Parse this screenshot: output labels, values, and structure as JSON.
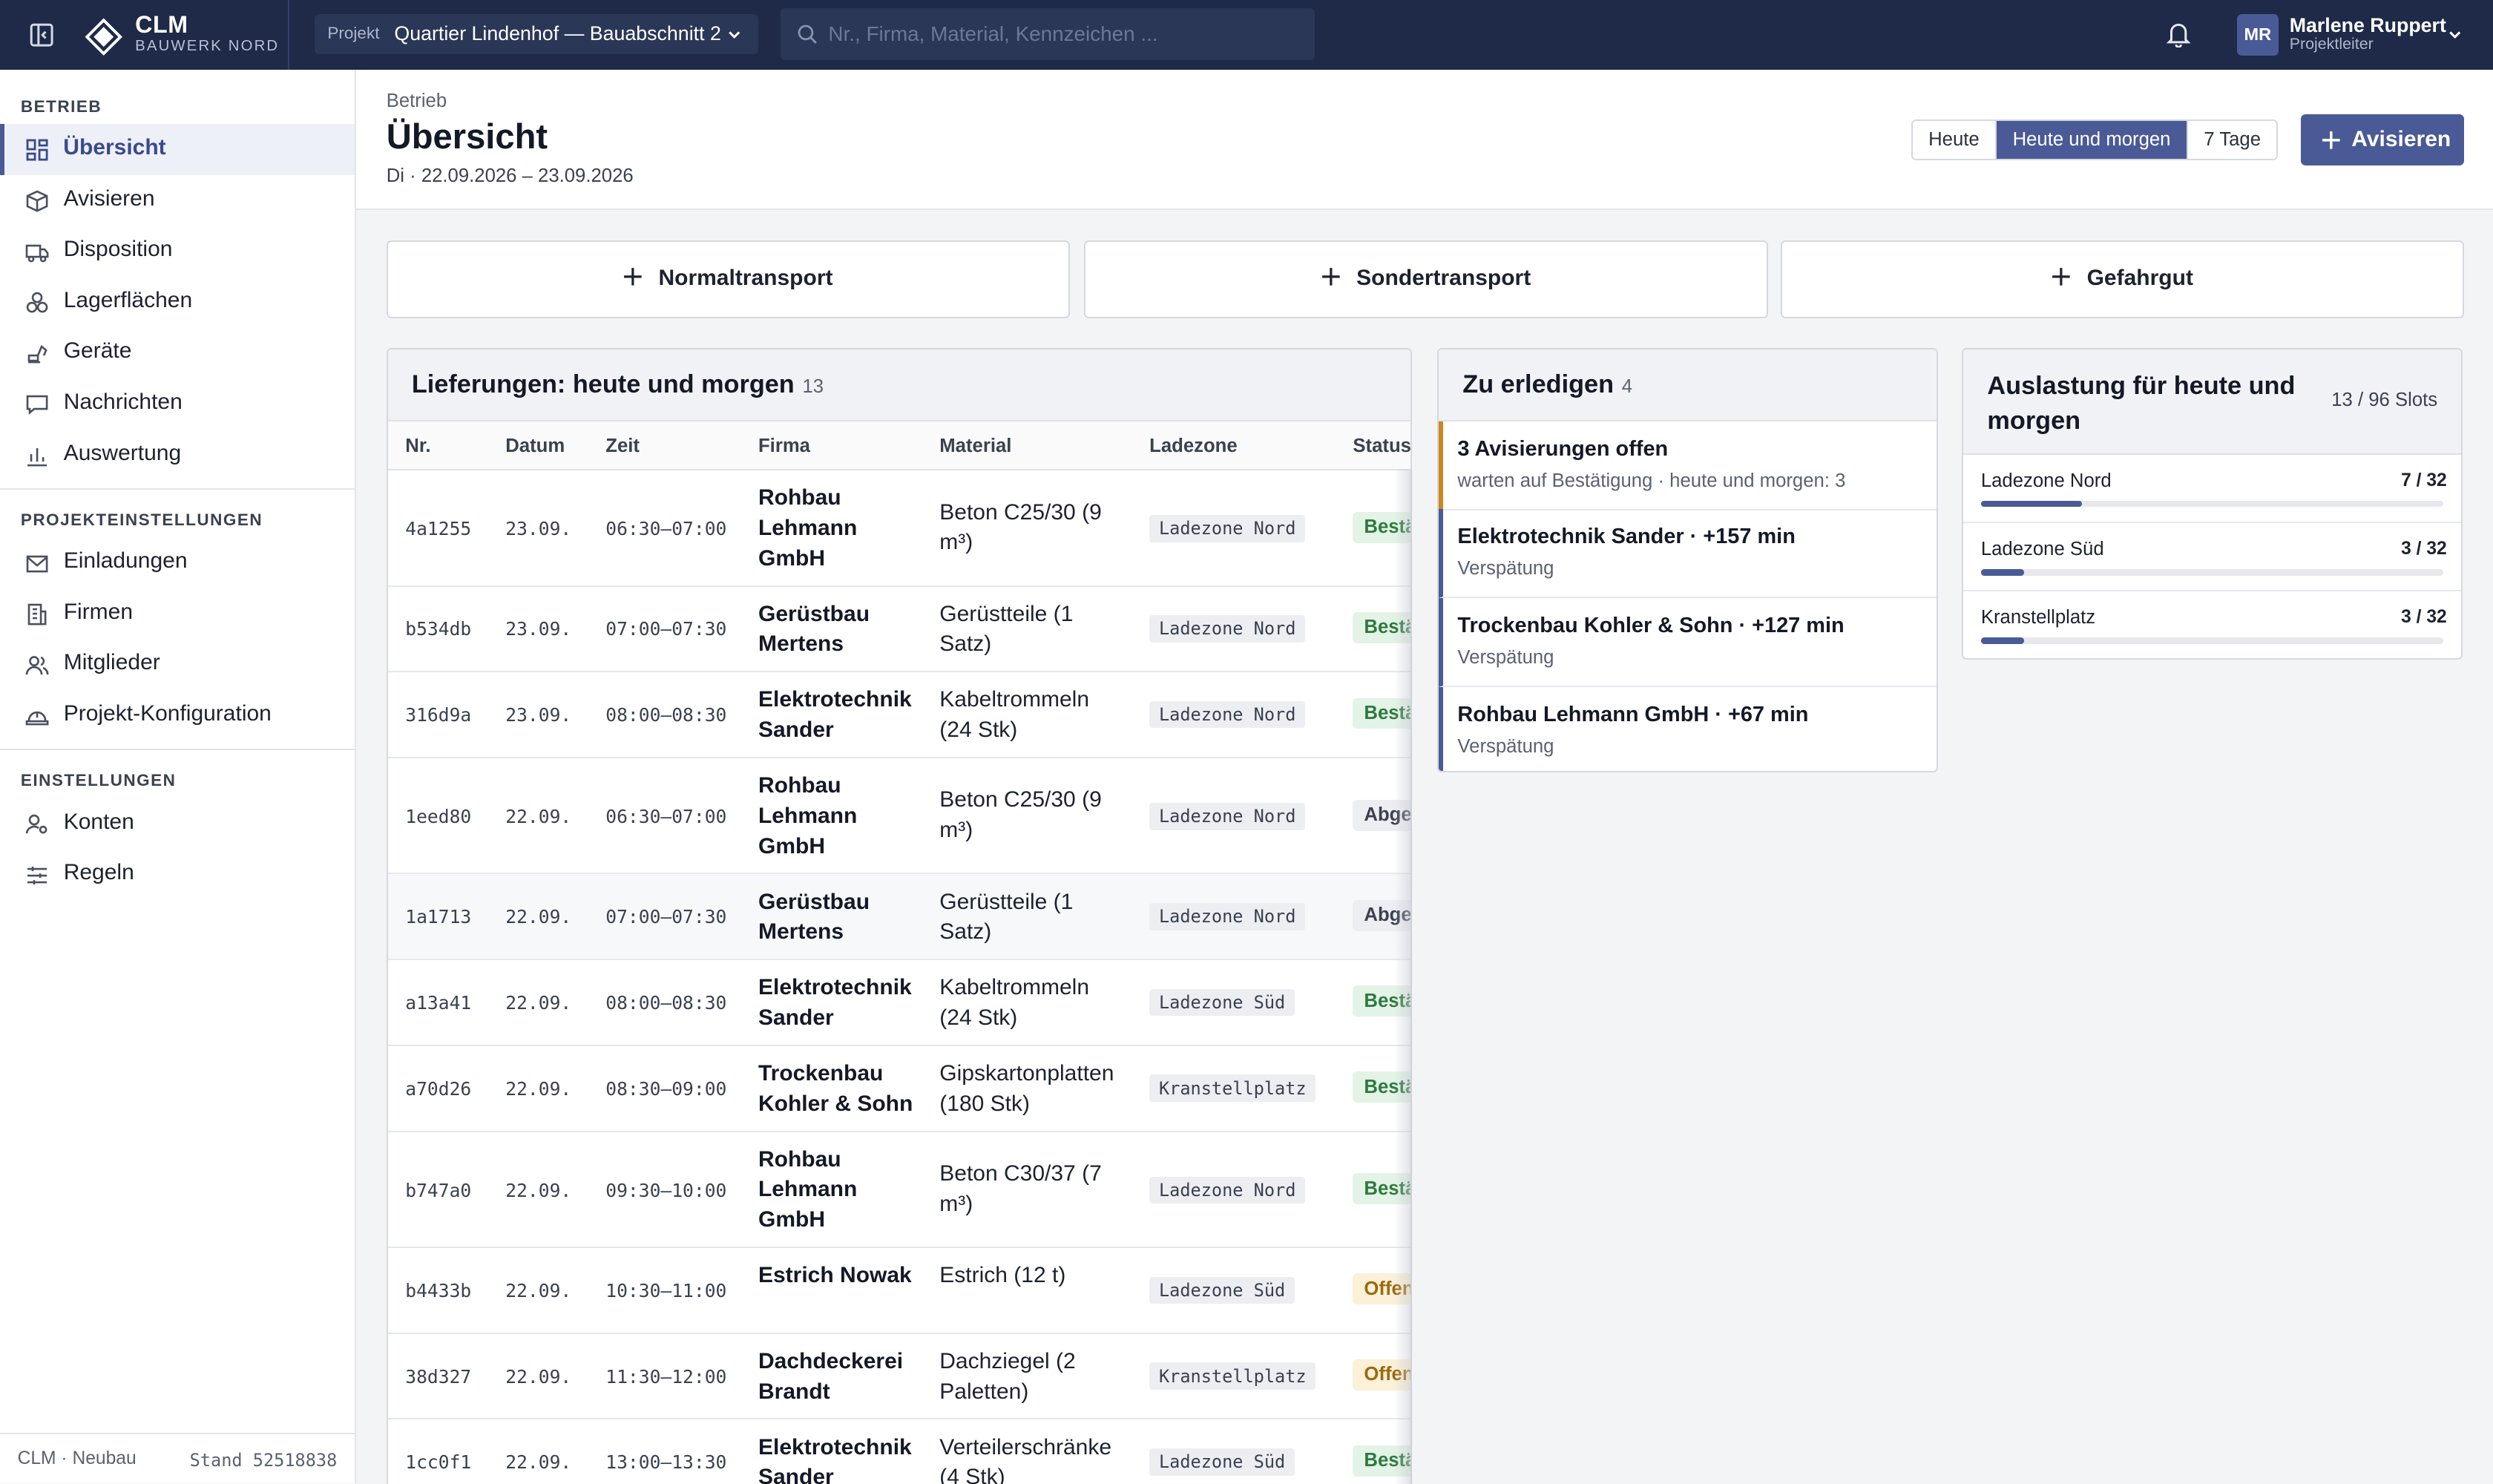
{
  "brand": {
    "name": "CLM",
    "sub": "BAUWERK NORD"
  },
  "project": {
    "label": "Projekt",
    "value": "Quartier Lindenhof — Bauabschnitt 2"
  },
  "search": {
    "placeholder": "Nr., Firma, Material, Kennzeichen ..."
  },
  "user": {
    "initials": "MR",
    "name": "Marlene Ruppert",
    "role": "Projektleiter"
  },
  "sidebar": {
    "sections": [
      {
        "title": "BETRIEB",
        "items": [
          "Übersicht",
          "Avisieren",
          "Disposition",
          "Lagerflächen",
          "Geräte",
          "Nachrichten",
          "Auswertung"
        ]
      },
      {
        "title": "PROJEKTEINSTELLUNGEN",
        "items": [
          "Einladungen",
          "Firmen",
          "Mitglieder",
          "Projekt-Konfiguration"
        ]
      },
      {
        "title": "EINSTELLUNGEN",
        "items": [
          "Konten",
          "Regeln"
        ]
      }
    ],
    "footer_left": "CLM · Neubau",
    "footer_right": "Stand 52518838"
  },
  "header": {
    "crumb": "Betrieb",
    "title": "Übersicht",
    "date": "Di · 22.09.2026 – 23.09.2026",
    "ranges": [
      "Heute",
      "Heute und morgen",
      "7 Tage"
    ],
    "active_range": 1,
    "primary": "Avisieren"
  },
  "quick_actions": [
    "Normaltransport",
    "Sondertransport",
    "Gefahrgut"
  ],
  "deliveries": {
    "title": "Lieferungen: heute und morgen",
    "count": "13",
    "columns": [
      "Nr.",
      "Datum",
      "Zeit",
      "Firma",
      "Material",
      "Ladezone",
      "Status"
    ],
    "rows": [
      {
        "nr": "4a1255",
        "date": "23.09.",
        "time": "06:30–07:00",
        "firm": "Rohbau Lehmann GmbH",
        "material": "Beton C25/30 (9 m³)",
        "zone": "Ladezone Nord",
        "status": "Bestä",
        "tone": "green"
      },
      {
        "nr": "b534db",
        "date": "23.09.",
        "time": "07:00–07:30",
        "firm": "Gerüstbau Mertens",
        "material": "Gerüstteile (1 Satz)",
        "zone": "Ladezone Nord",
        "status": "Bestä",
        "tone": "green"
      },
      {
        "nr": "316d9a",
        "date": "23.09.",
        "time": "08:00–08:30",
        "firm": "Elektrotechnik Sander",
        "material": "Kabeltrommeln (24 Stk)",
        "zone": "Ladezone Nord",
        "status": "Bestä",
        "tone": "green"
      },
      {
        "nr": "1eed80",
        "date": "22.09.",
        "time": "06:30–07:00",
        "firm": "Rohbau Lehmann GmbH",
        "material": "Beton C25/30 (9 m³)",
        "zone": "Ladezone Nord",
        "status": "Abges",
        "tone": "gray"
      },
      {
        "nr": "1a1713",
        "date": "22.09.",
        "time": "07:00–07:30",
        "firm": "Gerüstbau Mertens",
        "material": "Gerüstteile (1 Satz)",
        "zone": "Ladezone Nord",
        "status": "Abges",
        "tone": "gray"
      },
      {
        "nr": "a13a41",
        "date": "22.09.",
        "time": "08:00–08:30",
        "firm": "Elektrotechnik Sander",
        "material": "Kabeltrommeln (24 Stk)",
        "zone": "Ladezone Süd",
        "status": "Bestä",
        "tone": "green"
      },
      {
        "nr": "a70d26",
        "date": "22.09.",
        "time": "08:30–09:00",
        "firm": "Trockenbau Kohler & Sohn",
        "material": "Gipskartonplatten (180 Stk)",
        "zone": "Kranstellplatz",
        "status": "Bestä",
        "tone": "green"
      },
      {
        "nr": "b747a0",
        "date": "22.09.",
        "time": "09:30–10:00",
        "firm": "Rohbau Lehmann GmbH",
        "material": "Beton C30/37 (7 m³)",
        "zone": "Ladezone Nord",
        "status": "Bestä",
        "tone": "green"
      },
      {
        "nr": "b4433b",
        "date": "22.09.",
        "time": "10:30–11:00",
        "firm": "Estrich Nowak",
        "material": "Estrich (12 t)",
        "zone": "Ladezone Süd",
        "status": "Offen",
        "tone": "amber"
      },
      {
        "nr": "38d327",
        "date": "22.09.",
        "time": "11:30–12:00",
        "firm": "Dachdeckerei Brandt",
        "material": "Dachziegel (2 Paletten)",
        "zone": "Kranstellplatz",
        "status": "Offen",
        "tone": "amber"
      },
      {
        "nr": "1cc0f1",
        "date": "22.09.",
        "time": "13:00–13:30",
        "firm": "Elektrotechnik Sander",
        "material": "Verteilerschränke (4 Stk)",
        "zone": "Ladezone Süd",
        "status": "Bestä",
        "tone": "green"
      }
    ]
  },
  "todo": {
    "title": "Zu erledigen",
    "count": "4",
    "items": [
      {
        "title": "3 Avisierungen offen",
        "sub": "warten auf Bestätigung · heute und morgen: 3",
        "accent": "#c8881a"
      },
      {
        "title": "Elektrotechnik Sander · +157 min",
        "sub": "Verspätung",
        "accent": "#4a5a97"
      },
      {
        "title": "Trockenbau Kohler & Sohn · +127 min",
        "sub": "Verspätung",
        "accent": "#4a5a97"
      },
      {
        "title": "Rohbau Lehmann GmbH · +67 min",
        "sub": "Verspätung",
        "accent": "#4a5a97"
      }
    ]
  },
  "utilization": {
    "title": "Auslastung für heute und morgen",
    "summary": "13 / 96 Slots",
    "zones": [
      {
        "name": "Ladezone Nord",
        "used": 7,
        "total": 32,
        "label": "7  /  32"
      },
      {
        "name": "Ladezone Süd",
        "used": 3,
        "total": 32,
        "label": "3  /  32"
      },
      {
        "name": "Kranstellplatz",
        "used": 3,
        "total": 32,
        "label": "3  /  32"
      }
    ]
  },
  "colors": {
    "topbar": "#1e2a47",
    "accent": "#4a5a97",
    "amber": "#c8881a"
  }
}
